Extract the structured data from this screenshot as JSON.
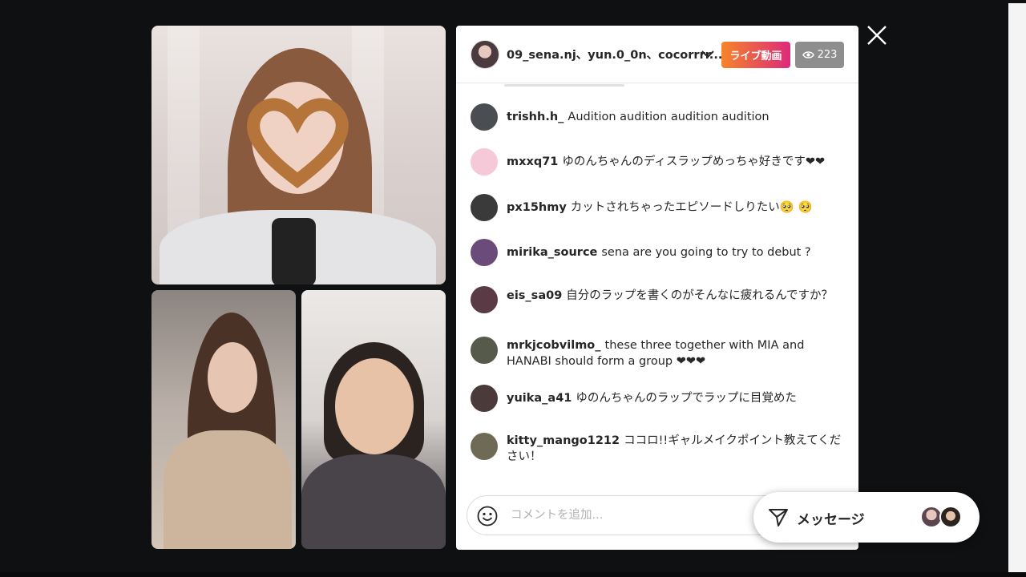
{
  "panel": {
    "host_names": "09_sena.nj、yun.0_0n、cocorrrr...",
    "live_label": "ライブ動画",
    "viewer_count": "223"
  },
  "comments": [
    {
      "user": "trishh.h_",
      "text": "Audition audition audition audition",
      "avatar_color": "#4a4e52"
    },
    {
      "user": "mxxq71",
      "text": "ゆのんちゃんのディスラップめっちゃ好きです❤❤",
      "avatar_color": "#f6c9d9"
    },
    {
      "user": "px15hmy",
      "text": "カットされちゃったエピソードしりたい🥺 🥺",
      "avatar_color": "#3a3a3a"
    },
    {
      "user": "mirika_source",
      "text": "sena are you going to try to debut ?",
      "avatar_color": "#6b4b7a"
    },
    {
      "user": "eis_sa09",
      "text": "自分のラップを書くのがそんなに疲れるんですか？",
      "avatar_color": "#5a3a44"
    },
    {
      "user": "mrkjcobvilmo_",
      "text": "these three together with MIA and HANABI should form a group ❤❤❤",
      "avatar_color": "#565a4a"
    },
    {
      "user": "yuika_a41",
      "text": "ゆのんちゃんのラップでラップに目覚めた",
      "avatar_color": "#4a3b3a"
    },
    {
      "user": "kitty_mango1212",
      "text": "ココロ!!ギャルメイクポイント教えてください！",
      "avatar_color": "#6e6a55"
    }
  ],
  "comment_bar": {
    "placeholder": "コメントを追加..."
  },
  "message_pill": {
    "label": "メッセージ"
  },
  "icons": {
    "close": "close-icon",
    "chevron": "chevron-down-icon",
    "eye": "eye-icon",
    "emoji": "emoji-icon",
    "send": "send-icon"
  },
  "colors": {
    "live_gradient_start": "#f58529",
    "live_gradient_end": "#dd2a7b",
    "viewer_badge": "#8e8e8e",
    "background": "#0e1012"
  }
}
